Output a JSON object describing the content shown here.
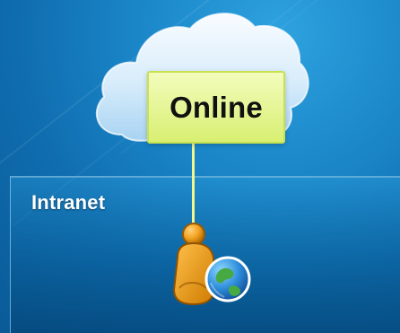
{
  "diagram": {
    "status_label": "Online",
    "network_label": "Intranet",
    "icons": {
      "cloud": "cloud-icon",
      "user": "user-icon",
      "globe": "globe-icon"
    },
    "colors": {
      "background": "#1a86c8",
      "status_fill": "#dff487",
      "status_border": "#c8e14f",
      "connector": "#f3f58d",
      "panel_border": "#82c8f0",
      "user": "#f2a322",
      "globe_ocean": "#2d8cdb",
      "globe_land": "#47a942"
    }
  }
}
